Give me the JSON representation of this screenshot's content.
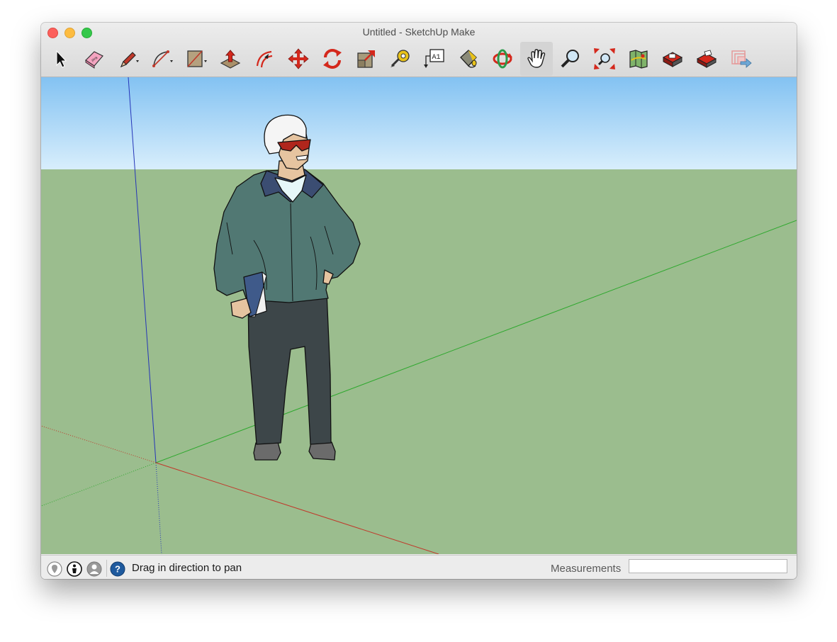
{
  "window": {
    "title": "Untitled - SketchUp Make"
  },
  "toolbar": {
    "tools": [
      {
        "name": "select-tool",
        "icon": "arrow-cursor-icon",
        "label": ""
      },
      {
        "name": "eraser-tool",
        "icon": "eraser-icon",
        "label": ""
      },
      {
        "name": "line-tool",
        "icon": "pencil-icon",
        "label": "",
        "has_menu": true
      },
      {
        "name": "arc-tool",
        "icon": "arc-icon",
        "label": "",
        "has_menu": true
      },
      {
        "name": "rectangle-tool",
        "icon": "rectangle-icon",
        "label": "",
        "has_menu": true
      },
      {
        "name": "push-pull-tool",
        "icon": "push-pull-icon",
        "label": ""
      },
      {
        "name": "offset-tool",
        "icon": "offset-icon",
        "label": ""
      },
      {
        "name": "move-tool",
        "icon": "move-arrows-icon",
        "label": ""
      },
      {
        "name": "rotate-tool",
        "icon": "rotate-icon",
        "label": ""
      },
      {
        "name": "scale-tool",
        "icon": "scale-icon",
        "label": ""
      },
      {
        "name": "tape-measure-tool",
        "icon": "tape-measure-icon",
        "label": ""
      },
      {
        "name": "text-tool",
        "icon": "text-label-icon",
        "label": "A1"
      },
      {
        "name": "paint-bucket-tool",
        "icon": "paint-bucket-icon",
        "label": ""
      },
      {
        "name": "orbit-tool",
        "icon": "orbit-icon",
        "label": ""
      },
      {
        "name": "pan-tool",
        "icon": "hand-icon",
        "label": "",
        "active": true
      },
      {
        "name": "zoom-tool",
        "icon": "magnifier-icon",
        "label": ""
      },
      {
        "name": "zoom-extents-tool",
        "icon": "zoom-extents-icon",
        "label": ""
      },
      {
        "name": "3d-warehouse-tool",
        "icon": "map-icon",
        "label": ""
      },
      {
        "name": "extension-warehouse-tool",
        "icon": "warehouse-icon",
        "label": ""
      },
      {
        "name": "extension-manager-tool",
        "icon": "extension-icon",
        "label": ""
      },
      {
        "name": "share-model-tool",
        "icon": "share-arrow-icon",
        "label": ""
      }
    ]
  },
  "colors": {
    "sky_top": "#83c2f2",
    "sky_bottom": "#d8eefc",
    "ground": "#9bbd8e",
    "axis_red": "#c0392b",
    "axis_green": "#2ea82e",
    "axis_blue": "#2535b8",
    "jacket": "#517873",
    "pants": "#3d4649"
  },
  "statusbar": {
    "status_text": "Drag in direction to pan",
    "measurements_label": "Measurements",
    "measurements_value": ""
  }
}
